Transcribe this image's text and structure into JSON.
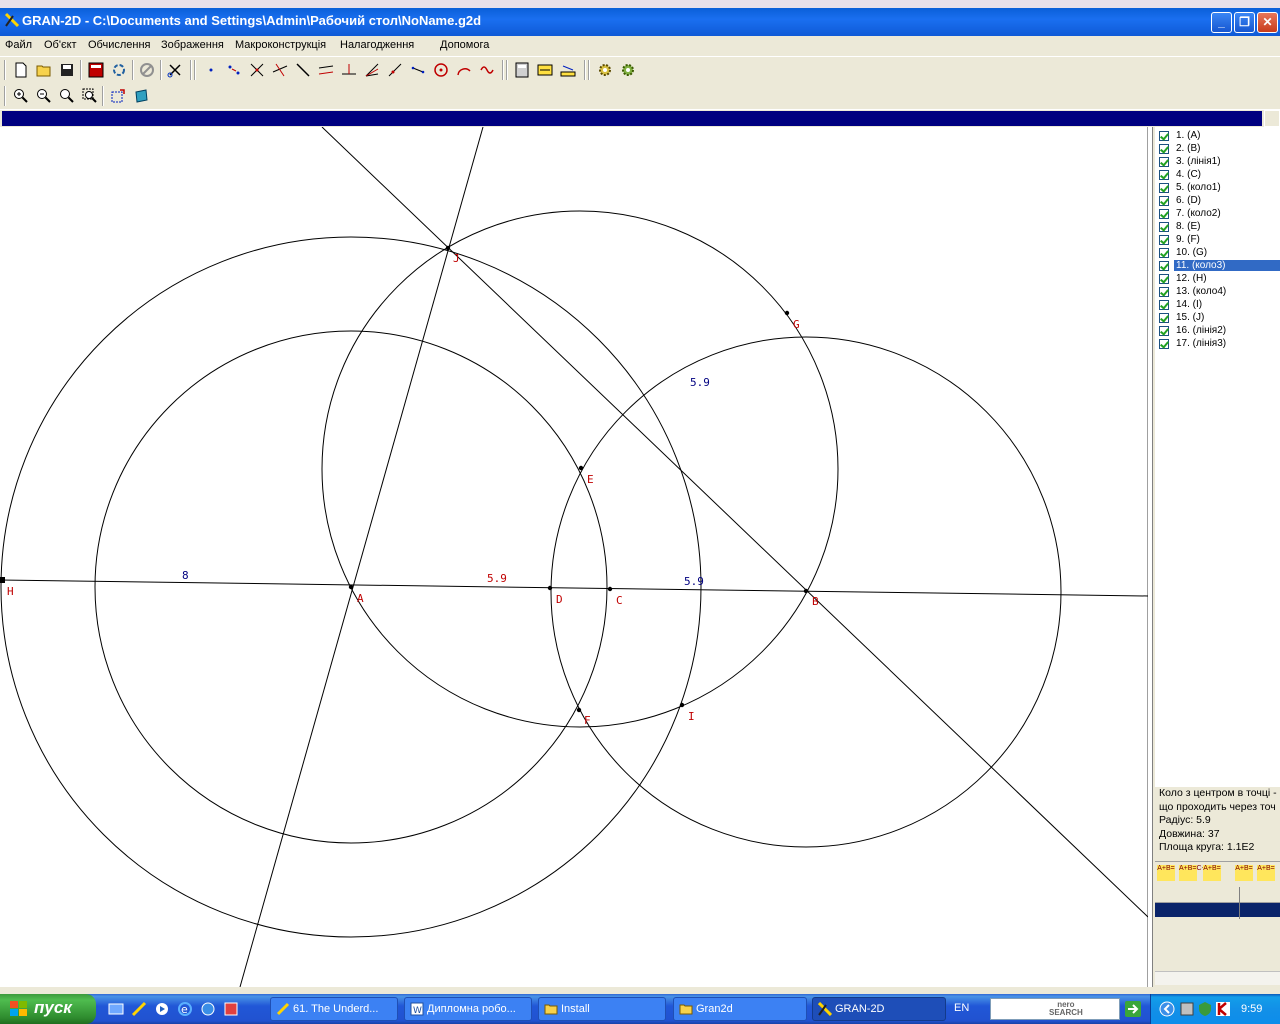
{
  "window": {
    "title": "GRAN-2D - C:\\Documents and Settings\\Admin\\Рабочий стол\\NoName.g2d",
    "minimize_label": "_",
    "maximize_label": "❐",
    "close_label": "✕"
  },
  "menu": [
    "Файл",
    "Об'єкт",
    "Обчислення",
    "Зображення",
    "Макроконструкція",
    "Налагодження",
    "Допомога"
  ],
  "canvas": {
    "points": [
      {
        "name": "A"
      },
      {
        "name": "B"
      },
      {
        "name": "C"
      },
      {
        "name": "D"
      },
      {
        "name": "E"
      },
      {
        "name": "F"
      },
      {
        "name": "G"
      },
      {
        "name": "H"
      },
      {
        "name": "I"
      },
      {
        "name": "J"
      }
    ],
    "measure_labels": [
      "8",
      "5.9",
      "5.9",
      "5.9"
    ]
  },
  "object_list": [
    {
      "label": "1.  (A)",
      "selected": false
    },
    {
      "label": "2.  (B)",
      "selected": false
    },
    {
      "label": "3.  (лінія1)",
      "selected": false
    },
    {
      "label": "4.  (C)",
      "selected": false
    },
    {
      "label": "5.  (коло1)",
      "selected": false
    },
    {
      "label": "6.  (D)",
      "selected": false
    },
    {
      "label": "7.  (коло2)",
      "selected": false
    },
    {
      "label": "8.  (E)",
      "selected": false
    },
    {
      "label": "9.  (F)",
      "selected": false
    },
    {
      "label": "10.  (G)",
      "selected": false
    },
    {
      "label": "11.  (коло3)",
      "selected": true
    },
    {
      "label": "12.  (H)",
      "selected": false
    },
    {
      "label": "13.  (коло4)",
      "selected": false
    },
    {
      "label": "14.  (I)",
      "selected": false
    },
    {
      "label": "15.  (J)",
      "selected": false
    },
    {
      "label": "16.  (лінія2)",
      "selected": false
    },
    {
      "label": "17.  (лінія3)",
      "selected": false
    }
  ],
  "info": {
    "line1": "Коло з центром в точці -",
    "line2": "що проходить через точ",
    "line3": "Радіус: 5.9",
    "line4": "Довжина: 37",
    "line5": "Площа круга: 1.1E2"
  },
  "calc_buttons": [
    "A+B=",
    "A+B=C+D=",
    "A+B=",
    "A+B=",
    "A+B="
  ],
  "taskbar": {
    "start_label": "пуск",
    "tasks": [
      {
        "label": "61. The Underd...",
        "active": false
      },
      {
        "label": "Дипломна робо...",
        "active": false
      },
      {
        "label": "Install",
        "active": false
      },
      {
        "label": "Gran2d",
        "active": false
      },
      {
        "label": "GRAN-2D",
        "active": true
      }
    ],
    "language": "EN",
    "search_brand_top": "nero",
    "search_brand_bottom": "SEARCH",
    "clock": "9:59"
  },
  "colors": {
    "label_red": "#c00000",
    "measure_blue": "#000080",
    "measure_red": "#c00000",
    "selection_blue": "#316ac5"
  }
}
